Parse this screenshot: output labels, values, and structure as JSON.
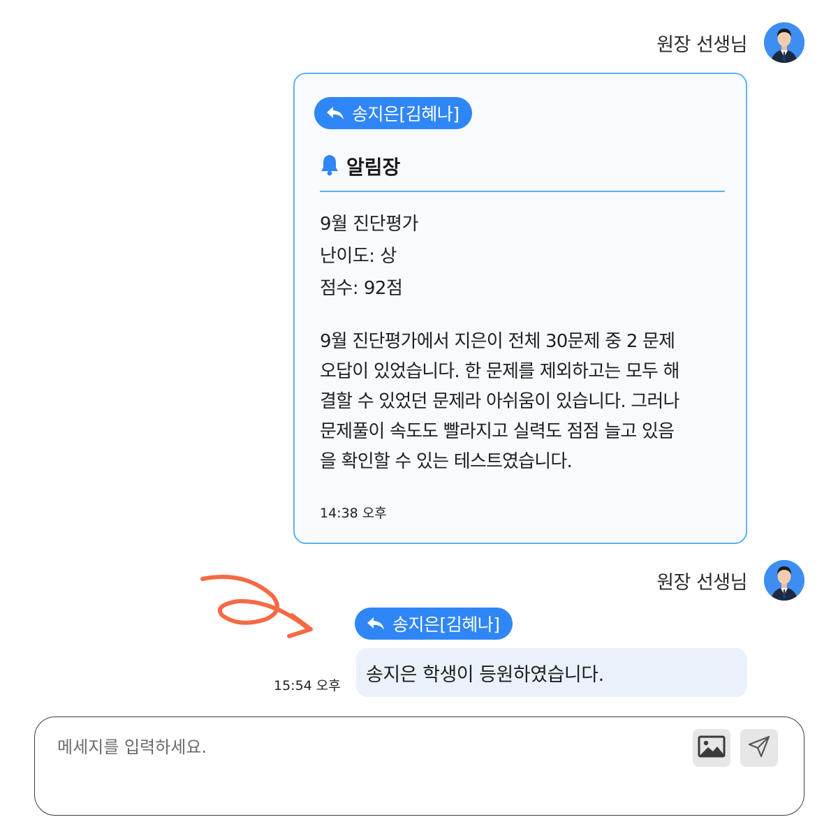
{
  "messages": [
    {
      "sender": "원장 선생님",
      "reply_to": "송지은[김혜나]",
      "notice": {
        "title": "알림장",
        "summary": [
          "9월 진단평가",
          "난이도: 상",
          "점수: 92점"
        ],
        "body_lines": [
          "9월 진단평가에서 지은이 전체 30문제 중 2 문제",
          "오답이 있었습니다. 한 문제를 제외하고는 모두 해",
          "결할 수 있었던 문제라 아쉬움이 있습니다. 그러나",
          "문제풀이 속도도 빨라지고 실력도 점점 늘고 있음",
          "을 확인할 수 있는 테스트였습니다."
        ],
        "time": "14:38 오후"
      }
    },
    {
      "sender": "원장 선생님",
      "reply_to": "송지은[김혜나]",
      "text": "송지은 학생이 등원하였습니다.",
      "time": "15:54 오후"
    }
  ],
  "composer": {
    "placeholder": "메세지를 입력하세요.",
    "image_icon": "image-icon",
    "send_icon": "send-icon"
  },
  "colors": {
    "accent": "#2f86f6",
    "card_border": "#5ab1f0",
    "bubble_bg": "#eaf1fb",
    "arrow": "#f46a45"
  }
}
